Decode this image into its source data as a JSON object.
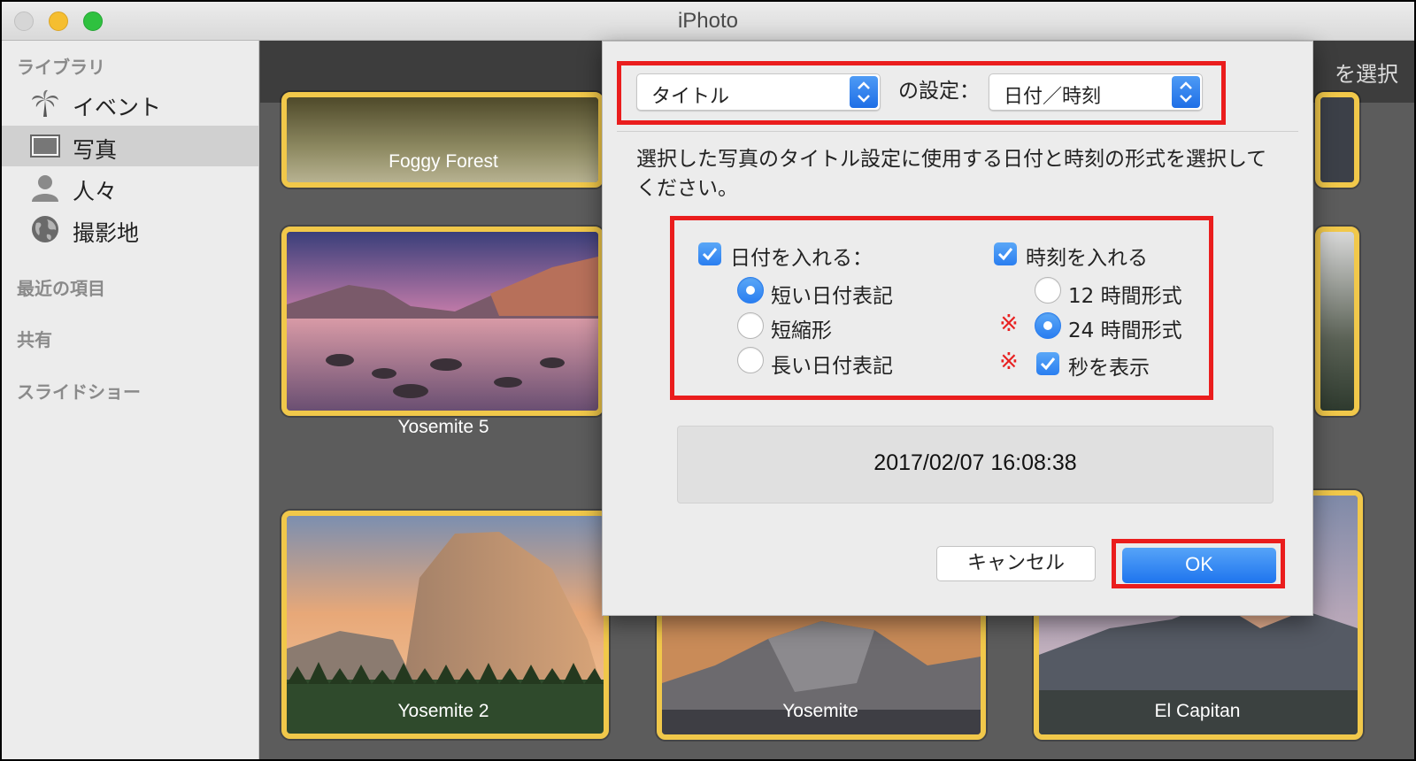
{
  "window": {
    "title": "iPhoto"
  },
  "sidebar": {
    "library_header": "ライブラリ",
    "items": [
      {
        "label": "イベント",
        "icon": "palm-tree-icon",
        "selected": false
      },
      {
        "label": "写真",
        "icon": "photo-icon",
        "selected": true
      },
      {
        "label": "人々",
        "icon": "person-icon",
        "selected": false
      },
      {
        "label": "撮影地",
        "icon": "globe-icon",
        "selected": false
      }
    ],
    "recent_header": "最近の項目",
    "shared_header": "共有",
    "slideshow_header": "スライドショー"
  },
  "toolbar": {
    "select_label": "を選択"
  },
  "photos": [
    {
      "caption": "Foggy Forest"
    },
    {
      "caption": "Yosemite 5"
    },
    {
      "caption": "Yosemite 2"
    },
    {
      "caption": "Yosemite"
    },
    {
      "caption": "El Capitan"
    }
  ],
  "dialog": {
    "field_popup": "タイトル",
    "setting_label": "の設定：",
    "value_popup": "日付／時刻",
    "description_line1": "選択した写真のタイトル設定に使用する日付と時刻の形式を選択して",
    "description_line2": "ください。",
    "include_date_label": "日付を入れる：",
    "include_date_checked": true,
    "date_options": [
      {
        "label": "短い日付表記",
        "selected": true
      },
      {
        "label": "短縮形",
        "selected": false
      },
      {
        "label": "長い日付表記",
        "selected": false
      }
    ],
    "include_time_label": "時刻を入れる",
    "include_time_checked": true,
    "time_options": [
      {
        "label": "12 時間形式",
        "selected": false
      },
      {
        "label": "24 時間形式",
        "selected": true
      }
    ],
    "show_seconds_label": "秒を表示",
    "show_seconds_checked": true,
    "note_mark": "※",
    "preview": "2017/02/07 16:08:38",
    "cancel_label": "キャンセル",
    "ok_label": "OK"
  },
  "colors": {
    "highlight": "#ea1d1d",
    "accent": "#2a7ef0",
    "thumb_border": "#f1c84a"
  }
}
